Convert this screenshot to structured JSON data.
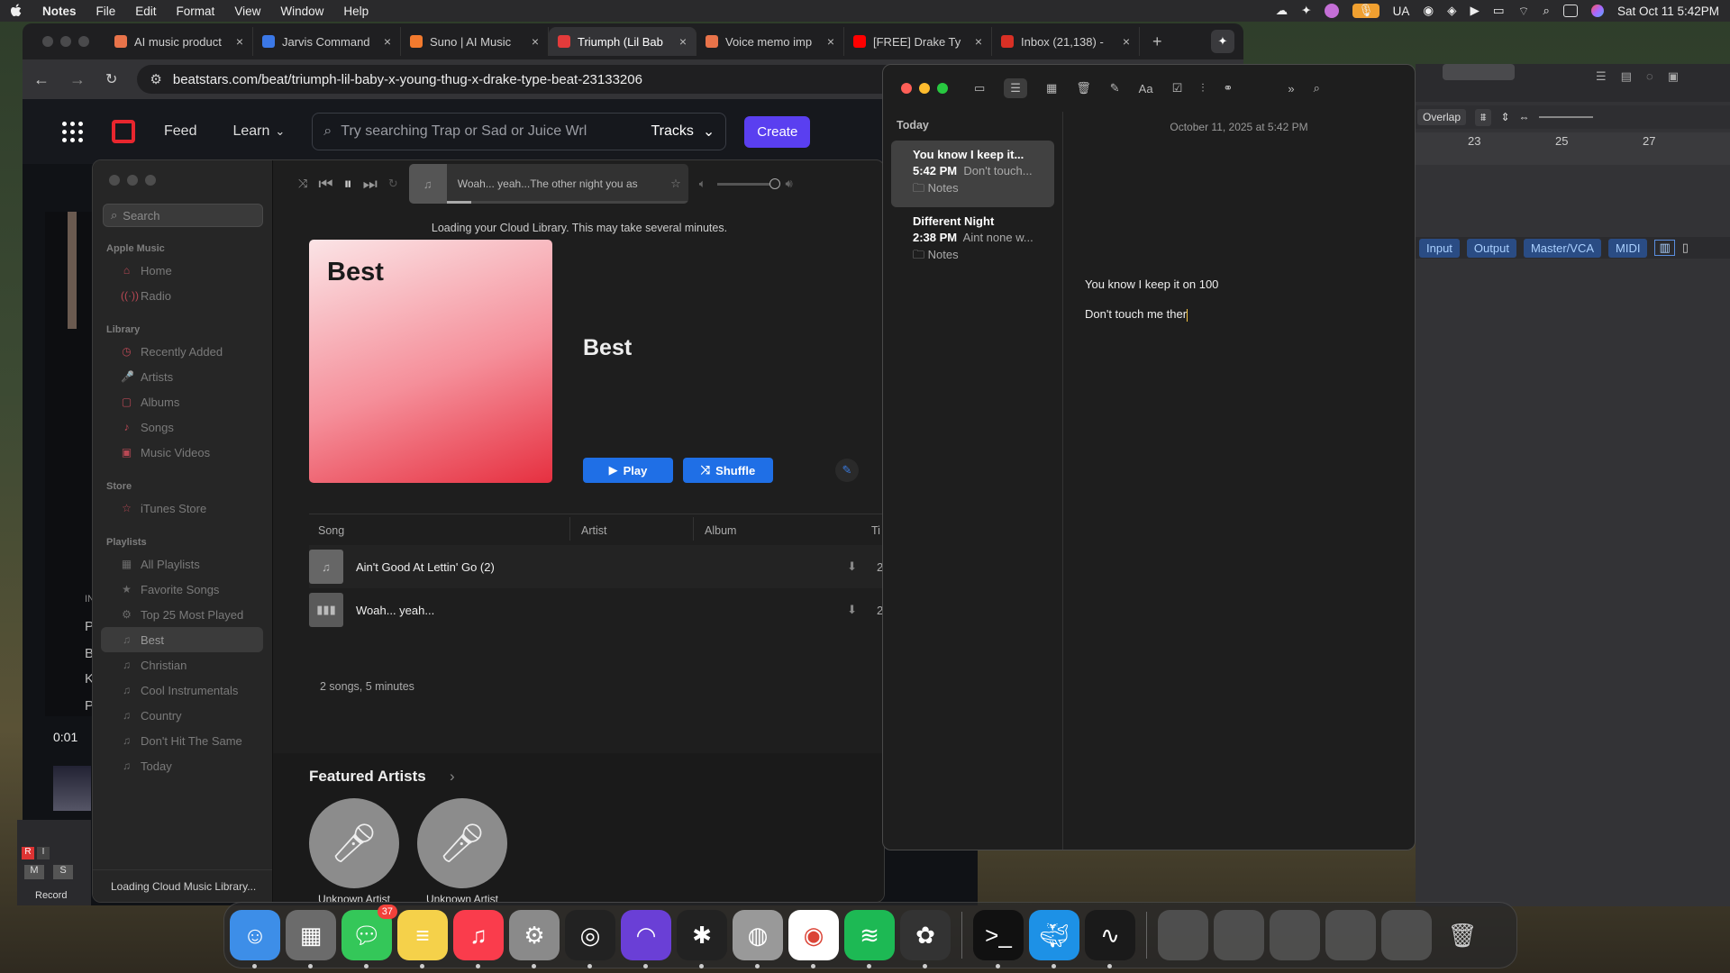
{
  "menubar": {
    "app_name": "Notes",
    "items": [
      "File",
      "Edit",
      "Format",
      "View",
      "Window",
      "Help"
    ],
    "input_lang": "UA",
    "clock": "Sat Oct 11  5:42PM"
  },
  "browser": {
    "tabs": [
      {
        "label": "AI music product",
        "color": "#e8734a"
      },
      {
        "label": "Jarvis Command",
        "color": "#3b78e7"
      },
      {
        "label": "Suno | AI Music",
        "color": "#f27a2e"
      },
      {
        "label": "Triumph (Lil Bab",
        "color": "#e33b3b"
      },
      {
        "label": "Voice memo imp",
        "color": "#e8734a"
      },
      {
        "label": "[FREE] Drake Ty",
        "color": "#ff0000"
      },
      {
        "label": "Inbox (21,138) -",
        "color": "#d93025"
      }
    ],
    "url": "beatstars.com/beat/triumph-lil-baby-x-young-thug-x-drake-type-beat-23133206"
  },
  "beatstars": {
    "nav": [
      "Feed",
      "Learn"
    ],
    "search_placeholder": "Try searching Trap or Sad or Juice Wrl",
    "search_scope": "Tracks",
    "create_label": "Create",
    "side_letters": [
      "INI",
      "Pu",
      "BP",
      "Ke",
      "Pl"
    ],
    "time": "0:01",
    "record_label": "Record",
    "mute": "M",
    "solo": "S",
    "r": "R",
    "i": "I"
  },
  "music": {
    "search_placeholder": "Search",
    "sections": [
      {
        "title": "Apple Music",
        "items": [
          {
            "label": "Home",
            "icon": "⌂"
          },
          {
            "label": "Radio",
            "icon": "((·))"
          }
        ]
      },
      {
        "title": "Library",
        "items": [
          {
            "label": "Recently Added",
            "icon": "◷"
          },
          {
            "label": "Artists",
            "icon": "🎤"
          },
          {
            "label": "Albums",
            "icon": "▢"
          },
          {
            "label": "Songs",
            "icon": "♪"
          },
          {
            "label": "Music Videos",
            "icon": "▣"
          }
        ]
      },
      {
        "title": "Store",
        "items": [
          {
            "label": "iTunes Store",
            "icon": "☆"
          }
        ]
      },
      {
        "title": "Playlists",
        "items": [
          {
            "label": "All Playlists",
            "icon": "▦"
          },
          {
            "label": "Favorite Songs",
            "icon": "★"
          },
          {
            "label": "Top 25 Most Played",
            "icon": "⚙"
          },
          {
            "label": "Best",
            "icon": "♫"
          },
          {
            "label": "Christian",
            "icon": "♫"
          },
          {
            "label": "Cool Instrumentals",
            "icon": "♫"
          },
          {
            "label": "Country",
            "icon": "♫"
          },
          {
            "label": "Don't Hit The Same",
            "icon": "♫"
          },
          {
            "label": "Today",
            "icon": "♫"
          }
        ]
      }
    ],
    "footer": "Loading Cloud Music Library...",
    "now_playing": "Woah... yeah...The other night you as",
    "loading_msg": "Loading your Cloud Library. This may take several minutes.",
    "playlist_art_title": "Best",
    "playlist_title": "Best",
    "play_label": "Play",
    "shuffle_label": "Shuffle",
    "columns": [
      "Song",
      "Artist",
      "Album",
      "Ti"
    ],
    "songs": [
      {
        "title": "Ain't Good At Lettin' Go (2)",
        "time": "2:"
      },
      {
        "title": "Woah... yeah...",
        "time": "2:"
      }
    ],
    "summary": "2 songs, 5 minutes",
    "featured_title": "Featured Artists",
    "featured_artists": [
      "Unknown Artist",
      "Unknown Artist"
    ]
  },
  "notes": {
    "group": "Today",
    "list": [
      {
        "title": "You know I keep it...",
        "time": "5:42 PM",
        "preview": "Don't touch...",
        "folder": "Notes"
      },
      {
        "title": "Different Night",
        "time": "2:38 PM",
        "preview": "Aint none w...",
        "folder": "Notes"
      }
    ],
    "date": "October 11, 2025 at 5:42 PM",
    "lines": [
      "You know I keep it on 100",
      "Don't touch me ther"
    ]
  },
  "logic": {
    "mode": "Overlap",
    "ruler": [
      "23",
      "25",
      "27"
    ],
    "tabs": [
      "Input",
      "Output",
      "Master/VCA",
      "MIDI"
    ]
  },
  "dock": {
    "apps": [
      {
        "name": "Finder",
        "color": "#3d8ee8"
      },
      {
        "name": "Launchpad",
        "color": "#6b6b6b"
      },
      {
        "name": "Messages",
        "color": "#34c759",
        "badge": "37"
      },
      {
        "name": "Notes",
        "color": "#f5d14a"
      },
      {
        "name": "Music",
        "color": "#fa3c4c"
      },
      {
        "name": "System Settings",
        "color": "#8a8a8a"
      },
      {
        "name": "Logic",
        "color": "#222"
      },
      {
        "name": "Arc",
        "color": "#6a3fd6"
      },
      {
        "name": "MainStage",
        "color": "#222"
      },
      {
        "name": "Compressor",
        "color": "#999"
      },
      {
        "name": "Chrome",
        "color": "#fff"
      },
      {
        "name": "Spotify",
        "color": "#1db954"
      },
      {
        "name": "ChatGPT",
        "color": "#333"
      },
      {
        "name": "Terminal",
        "color": "#111"
      },
      {
        "name": "Docker",
        "color": "#1d91e6"
      },
      {
        "name": "Voice Memos",
        "color": "#1a1a1a"
      }
    ]
  }
}
